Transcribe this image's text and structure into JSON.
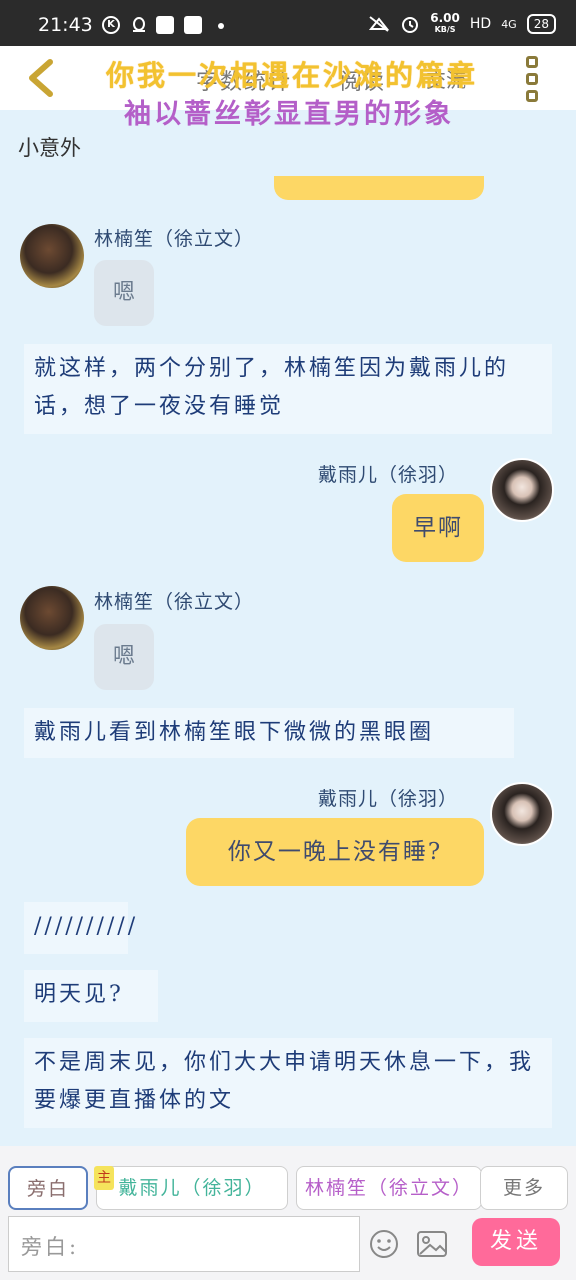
{
  "status_bar": {
    "time": "21:43",
    "speed_value": "6.00",
    "speed_unit": "KB/S",
    "network": "HD",
    "signal": "4G",
    "battery": "28"
  },
  "header": {
    "title_line1": "你我一次相遇在沙滩的篇章",
    "title_line2": "袖以蔷丝彰显直男的形象",
    "subtitle_a": "字数统计",
    "subtitle_b": "阅读",
    "subtitle_c": "交流",
    "back_icon": "chevron-left-icon",
    "more_icon": "more-vertical-icon"
  },
  "chat": {
    "previous_text": "小意外",
    "messages": [
      {
        "type": "left",
        "name": "林楠笙（徐立文）",
        "text": "嗯"
      },
      {
        "type": "narration",
        "text": "就这样，两个分别了，林楠笙因为戴雨儿的话，想了一夜没有睡觉"
      },
      {
        "type": "right",
        "name": "戴雨儿（徐羽）",
        "text": "早啊"
      },
      {
        "type": "left",
        "name": "林楠笙（徐立文）",
        "text": "嗯"
      },
      {
        "type": "narration",
        "text": "戴雨儿看到林楠笙眼下微微的黑眼圈"
      },
      {
        "type": "right",
        "name": "戴雨儿（徐羽）",
        "text": "你又一晚上没有睡?"
      },
      {
        "type": "narration",
        "text": "//////////"
      },
      {
        "type": "narration",
        "text": "明天见?"
      },
      {
        "type": "narration",
        "text": "不是周末见，你们大大申请明天休息一下，我要爆更直播体的文"
      }
    ]
  },
  "composer": {
    "tab_narration": "旁白",
    "tab_char1": "戴雨儿（徐羽）",
    "tab_char1_tag": "主",
    "tab_char2": "林楠笙（徐立文）",
    "tab_more": "更多",
    "input_placeholder": "旁白:",
    "send_label": "发送",
    "emoji_icon": "emoji-icon",
    "image_icon": "image-icon"
  },
  "colors": {
    "background": "#e3f2fb",
    "bubble_self": "#fdd765",
    "bubble_other": "#dde5ec",
    "send_button": "#ff6a9a",
    "title1": "#f2c230",
    "title2": "#b45fc8"
  }
}
